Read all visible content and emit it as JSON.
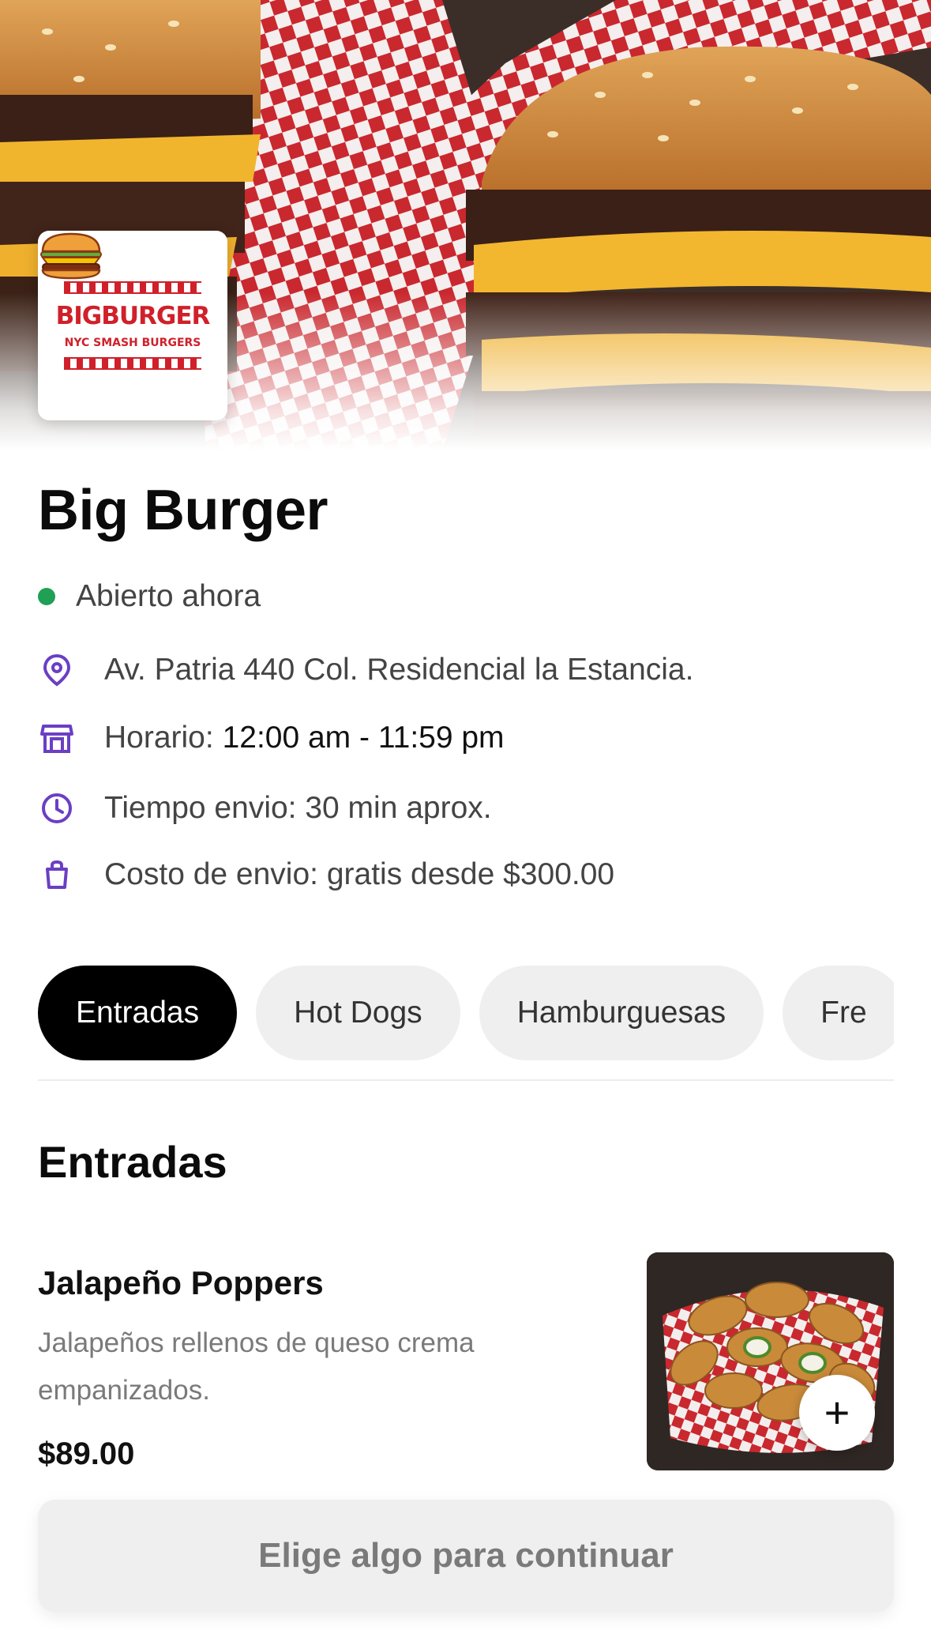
{
  "restaurant": {
    "logo": {
      "title": "BIGBURGER",
      "subtitle": "NYC SMASH BURGERS",
      "icon": "burger-icon"
    },
    "name": "Big Burger",
    "status": {
      "text": "Abierto ahora",
      "color": "#1fa055"
    },
    "info": {
      "address": "Av. Patria 440 Col. Residencial la Estancia.",
      "hours_label": "Horario:",
      "hours_value": "12:00 am - 11:59 pm",
      "delivery_time": "Tiempo envio: 30 min aprox.",
      "delivery_cost": "Costo de envio: gratis desde $300.00"
    }
  },
  "icons": {
    "address": "location-pin-icon",
    "hours": "store-icon",
    "time": "clock-icon",
    "cost": "bag-icon"
  },
  "colors": {
    "accent": "#6a3fc4",
    "brand_red": "#d0202a",
    "active_tab": "#000000"
  },
  "tabs": [
    {
      "label": "Entradas",
      "active": true
    },
    {
      "label": "Hot Dogs",
      "active": false
    },
    {
      "label": "Hamburguesas",
      "active": false
    },
    {
      "label": "Fre",
      "active": false
    }
  ],
  "section": {
    "title": "Entradas",
    "items": [
      {
        "name": "Jalapeño Poppers",
        "description": "Jalapeños rellenos de queso crema empanizados.",
        "price": "$89.00",
        "add_label": "+"
      }
    ]
  },
  "footer": {
    "cta_label": "Elige algo para continuar"
  }
}
